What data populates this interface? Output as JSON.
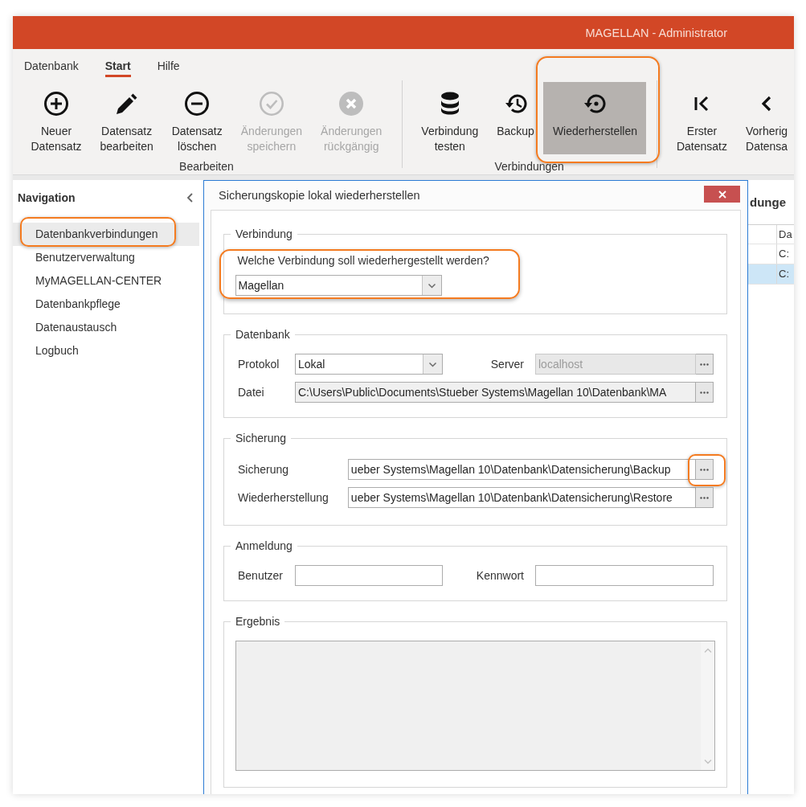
{
  "window": {
    "title": "MAGELLAN - Administrator"
  },
  "ribbon": {
    "tabs": [
      {
        "label": "Datenbank",
        "selected": false
      },
      {
        "label": "Start",
        "selected": true
      },
      {
        "label": "Hilfe",
        "selected": false
      }
    ],
    "groups": [
      {
        "label": "Bearbeiten",
        "buttons": [
          {
            "kind": "add",
            "label": "Neuer\nDatensatz",
            "disabled": false,
            "selected": false,
            "highlighted": false
          },
          {
            "kind": "edit",
            "label": "Datensatz\nbearbeiten",
            "disabled": false,
            "selected": false,
            "highlighted": false
          },
          {
            "kind": "delete",
            "label": "Datensatz\nlöschen",
            "disabled": false,
            "selected": false,
            "highlighted": false
          },
          {
            "kind": "save",
            "label": "Änderungen\nspeichern",
            "disabled": true,
            "selected": false,
            "highlighted": false
          },
          {
            "kind": "undo",
            "label": "Änderungen\nrückgängig",
            "disabled": true,
            "selected": false,
            "highlighted": false
          }
        ]
      },
      {
        "label": "Verbindungen",
        "buttons": [
          {
            "kind": "test",
            "label": "Verbindung\ntesten",
            "disabled": false,
            "selected": false,
            "highlighted": false
          },
          {
            "kind": "backup",
            "label": "Backup",
            "disabled": false,
            "selected": false,
            "highlighted": false
          },
          {
            "kind": "restore",
            "label": "Wiederherstellen",
            "disabled": false,
            "selected": true,
            "highlighted": true
          }
        ]
      },
      {
        "buttons": [
          {
            "kind": "first",
            "label": "Erster\nDatensatz",
            "disabled": false,
            "selected": false,
            "highlighted": false
          },
          {
            "kind": "previous",
            "label": "Vorherig\nDatensa",
            "disabled": false,
            "selected": false,
            "highlighted": false
          }
        ]
      }
    ]
  },
  "navigation": {
    "title": "Navigation",
    "items": [
      {
        "label": "Datenbankverbindungen",
        "selected": true,
        "highlighted": true
      },
      {
        "label": "Benutzerverwaltung",
        "selected": false,
        "highlighted": false
      },
      {
        "label": "MyMAGELLAN-CENTER",
        "selected": false,
        "highlighted": false
      },
      {
        "label": "Datenbankpflege",
        "selected": false,
        "highlighted": false
      },
      {
        "label": "Datenaustausch",
        "selected": false,
        "highlighted": false
      },
      {
        "label": "Logbuch",
        "selected": false,
        "highlighted": false
      }
    ]
  },
  "dialog": {
    "title": "Sicherungskopie lokal wiederherstellen",
    "sections": [
      {
        "kind": "question",
        "legend": "Verbindung",
        "highlighted": true,
        "question": "Welche Verbindung soll wiederhergestellt werden?",
        "field": {
          "kind": "select",
          "value": "Magellan",
          "disabled": false,
          "readonly": false
        }
      },
      {
        "kind": "grid",
        "legend": "Datenbank",
        "highlighted": false,
        "rows": [
          [
            {
              "label": "Protokol",
              "field": {
                "kind": "select",
                "value": "Lokal",
                "disabled": false,
                "readonly": false
              }
            },
            {
              "label": "Server",
              "field": {
                "kind": "browse",
                "value": "localhost",
                "disabled": true,
                "readonly": false,
                "button": {
                  "highlighted": false
                }
              }
            }
          ],
          [
            {
              "label": "Datei",
              "field": {
                "kind": "browse",
                "value": "C:\\Users\\Public\\Documents\\Stueber Systems\\Magellan 10\\Datenbank\\MA",
                "disabled": false,
                "readonly": true,
                "button": {
                  "highlighted": false
                }
              }
            }
          ]
        ]
      },
      {
        "kind": "list",
        "legend": "Sicherung",
        "highlighted": false,
        "rows": [
          [
            {
              "label": "Sicherung",
              "field": {
                "kind": "browse",
                "value": "ueber Systems\\Magellan 10\\Datenbank\\Datensicherung\\Backup",
                "disabled": false,
                "readonly": false,
                "button": {
                  "highlighted": true
                }
              }
            }
          ],
          [
            {
              "label": "Wiederherstellung",
              "field": {
                "kind": "browse",
                "value": "ueber Systems\\Magellan 10\\Datenbank\\Datensicherung\\Restore",
                "disabled": false,
                "readonly": false,
                "button": {
                  "highlighted": false
                }
              }
            }
          ]
        ]
      },
      {
        "kind": "grid",
        "legend": "Anmeldung",
        "highlighted": false,
        "rows": [
          [
            {
              "label": "Benutzer",
              "field": {
                "kind": "text",
                "disabled": false,
                "readonly": false
              }
            },
            {
              "label": "Kennwort",
              "field": {
                "kind": "text",
                "disabled": false,
                "readonly": false
              }
            }
          ]
        ]
      },
      {
        "kind": "output",
        "legend": "Ergebnis",
        "highlighted": false,
        "field": {
          "kind": "textarea",
          "disabled": false,
          "readonly": true
        }
      }
    ]
  },
  "content": {
    "heading": "dunge",
    "table": {
      "columns": [
        "Da"
      ],
      "rows": [
        {
          "cells": [
            "C:"
          ],
          "selected": false
        },
        {
          "cells": [
            "C:"
          ],
          "selected": true
        }
      ]
    }
  }
}
